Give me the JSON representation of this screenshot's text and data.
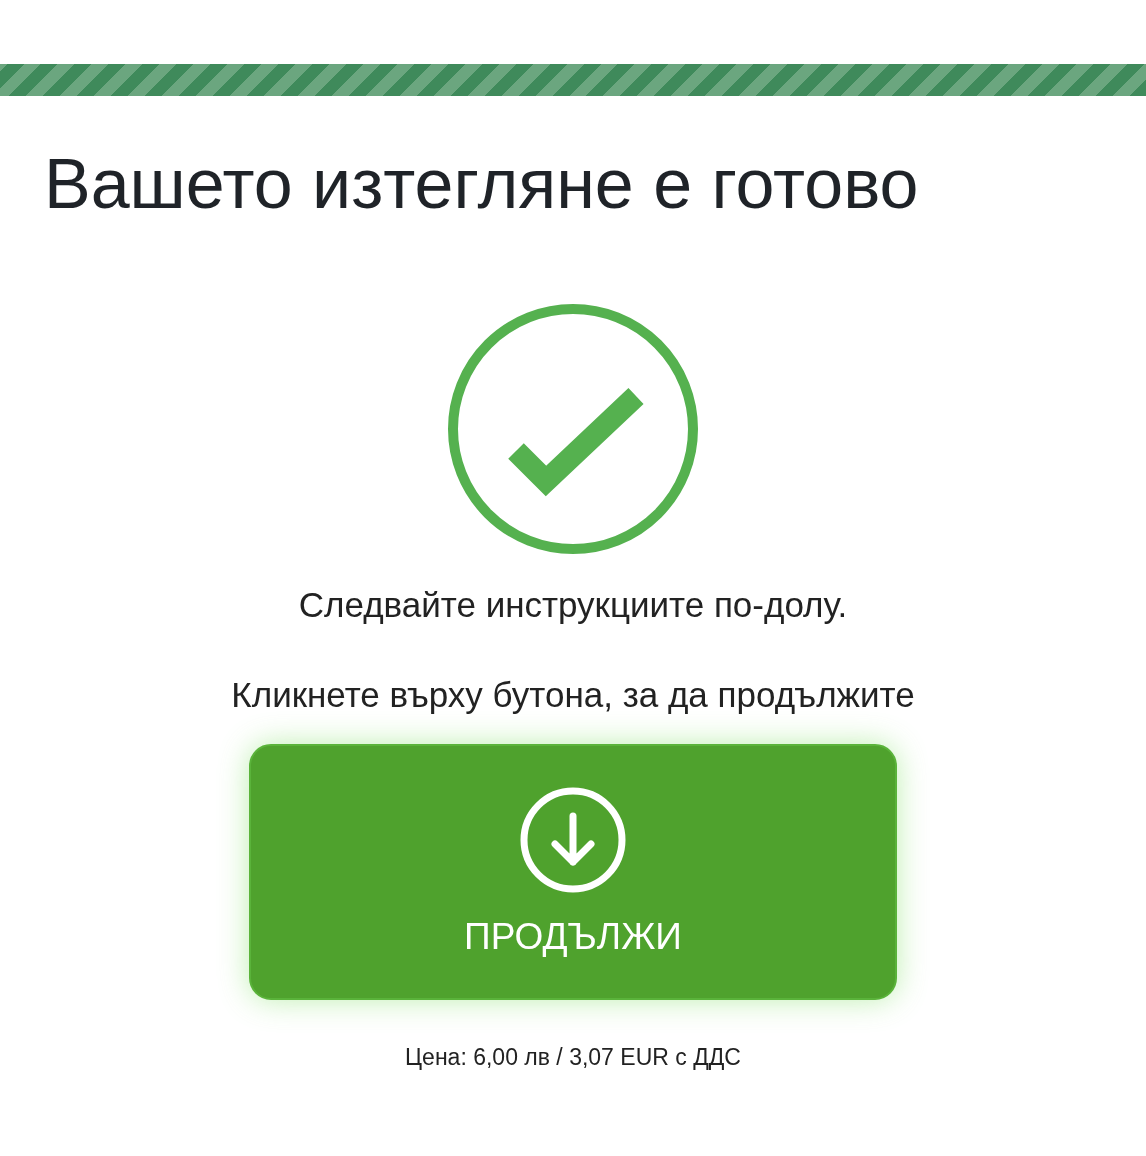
{
  "title": "Вашето изтегляне е готово",
  "instructions": "Следвайте инструкциите по-долу.",
  "prompt": "Кликнете върху бутона, за да продължите",
  "button": {
    "label": "ПРОДЪЛЖИ"
  },
  "price": "Цена: 6,00 лв / 3,07 EUR с ДДС"
}
